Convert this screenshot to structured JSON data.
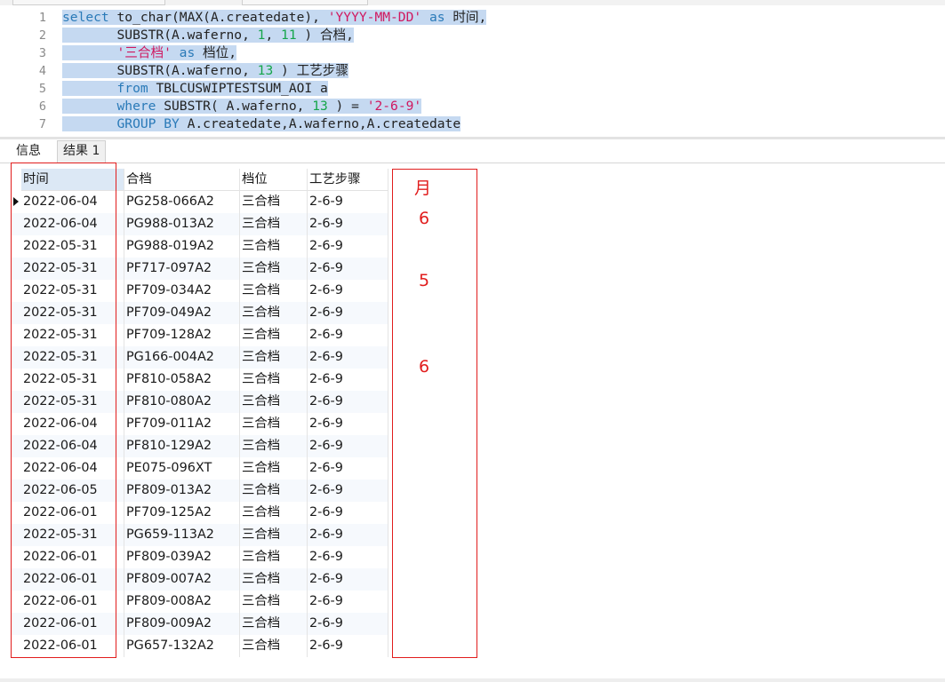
{
  "editor": {
    "line_numbers": [
      "1",
      "2",
      "3",
      "4",
      "5",
      "6",
      "7"
    ],
    "lines": [
      [
        {
          "t": "select",
          "c": "kw"
        },
        {
          "t": " to_char(MAX(A.createdate), "
        },
        {
          "t": "'YYYY-MM-DD'",
          "c": "str"
        },
        {
          "t": " "
        },
        {
          "t": "as",
          "c": "kw"
        },
        {
          "t": " 时间,"
        }
      ],
      [
        {
          "t": "       SUBSTR(A.waferno, "
        },
        {
          "t": "1",
          "c": "num"
        },
        {
          "t": ", "
        },
        {
          "t": "11",
          "c": "num"
        },
        {
          "t": " ) 合档,"
        }
      ],
      [
        {
          "t": "       "
        },
        {
          "t": "'三合档'",
          "c": "str"
        },
        {
          "t": " "
        },
        {
          "t": "as",
          "c": "kw"
        },
        {
          "t": " 档位,"
        }
      ],
      [
        {
          "t": "       SUBSTR(A.waferno, "
        },
        {
          "t": "13",
          "c": "num"
        },
        {
          "t": " ) 工艺步骤"
        }
      ],
      [
        {
          "t": "       "
        },
        {
          "t": "from",
          "c": "kw"
        },
        {
          "t": " TBLCUSWIPTESTSUM_AOI a"
        }
      ],
      [
        {
          "t": "       "
        },
        {
          "t": "where",
          "c": "kw"
        },
        {
          "t": " SUBSTR( A.waferno, "
        },
        {
          "t": "13",
          "c": "num"
        },
        {
          "t": " ) = "
        },
        {
          "t": "'2-6-9'",
          "c": "str"
        }
      ],
      [
        {
          "t": "       "
        },
        {
          "t": "GROUP BY",
          "c": "kw"
        },
        {
          "t": " A.createdate,A.waferno,A.createdate"
        }
      ]
    ]
  },
  "tabs": {
    "info": "信息",
    "result": "结果 1"
  },
  "grid": {
    "columns": [
      "时间",
      "合档",
      "档位",
      "工艺步骤"
    ],
    "rows": [
      [
        "2022-06-04",
        "PG258-066A2",
        "三合档",
        "2-6-9"
      ],
      [
        "2022-06-04",
        "PG988-013A2",
        "三合档",
        "2-6-9"
      ],
      [
        "2022-05-31",
        "PG988-019A2",
        "三合档",
        "2-6-9"
      ],
      [
        "2022-05-31",
        "PF717-097A2",
        "三合档",
        "2-6-9"
      ],
      [
        "2022-05-31",
        "PF709-034A2",
        "三合档",
        "2-6-9"
      ],
      [
        "2022-05-31",
        "PF709-049A2",
        "三合档",
        "2-6-9"
      ],
      [
        "2022-05-31",
        "PF709-128A2",
        "三合档",
        "2-6-9"
      ],
      [
        "2022-05-31",
        "PG166-004A2",
        "三合档",
        "2-6-9"
      ],
      [
        "2022-05-31",
        "PF810-058A2",
        "三合档",
        "2-6-9"
      ],
      [
        "2022-05-31",
        "PF810-080A2",
        "三合档",
        "2-6-9"
      ],
      [
        "2022-06-04",
        "PF709-011A2",
        "三合档",
        "2-6-9"
      ],
      [
        "2022-06-04",
        "PF810-129A2",
        "三合档",
        "2-6-9"
      ],
      [
        "2022-06-04",
        "PE075-096XT",
        "三合档",
        "2-6-9"
      ],
      [
        "2022-06-05",
        "PF809-013A2",
        "三合档",
        "2-6-9"
      ],
      [
        "2022-06-01",
        "PF709-125A2",
        "三合档",
        "2-6-9"
      ],
      [
        "2022-05-31",
        "PG659-113A2",
        "三合档",
        "2-6-9"
      ],
      [
        "2022-06-01",
        "PF809-039A2",
        "三合档",
        "2-6-9"
      ],
      [
        "2022-06-01",
        "PF809-007A2",
        "三合档",
        "2-6-9"
      ],
      [
        "2022-06-01",
        "PF809-008A2",
        "三合档",
        "2-6-9"
      ],
      [
        "2022-06-01",
        "PF809-009A2",
        "三合档",
        "2-6-9"
      ],
      [
        "2022-06-01",
        "PG657-132A2",
        "三合档",
        "2-6-9"
      ]
    ]
  },
  "annotations": {
    "header": "月",
    "a1": "6",
    "a2": "5",
    "a3": "6"
  }
}
